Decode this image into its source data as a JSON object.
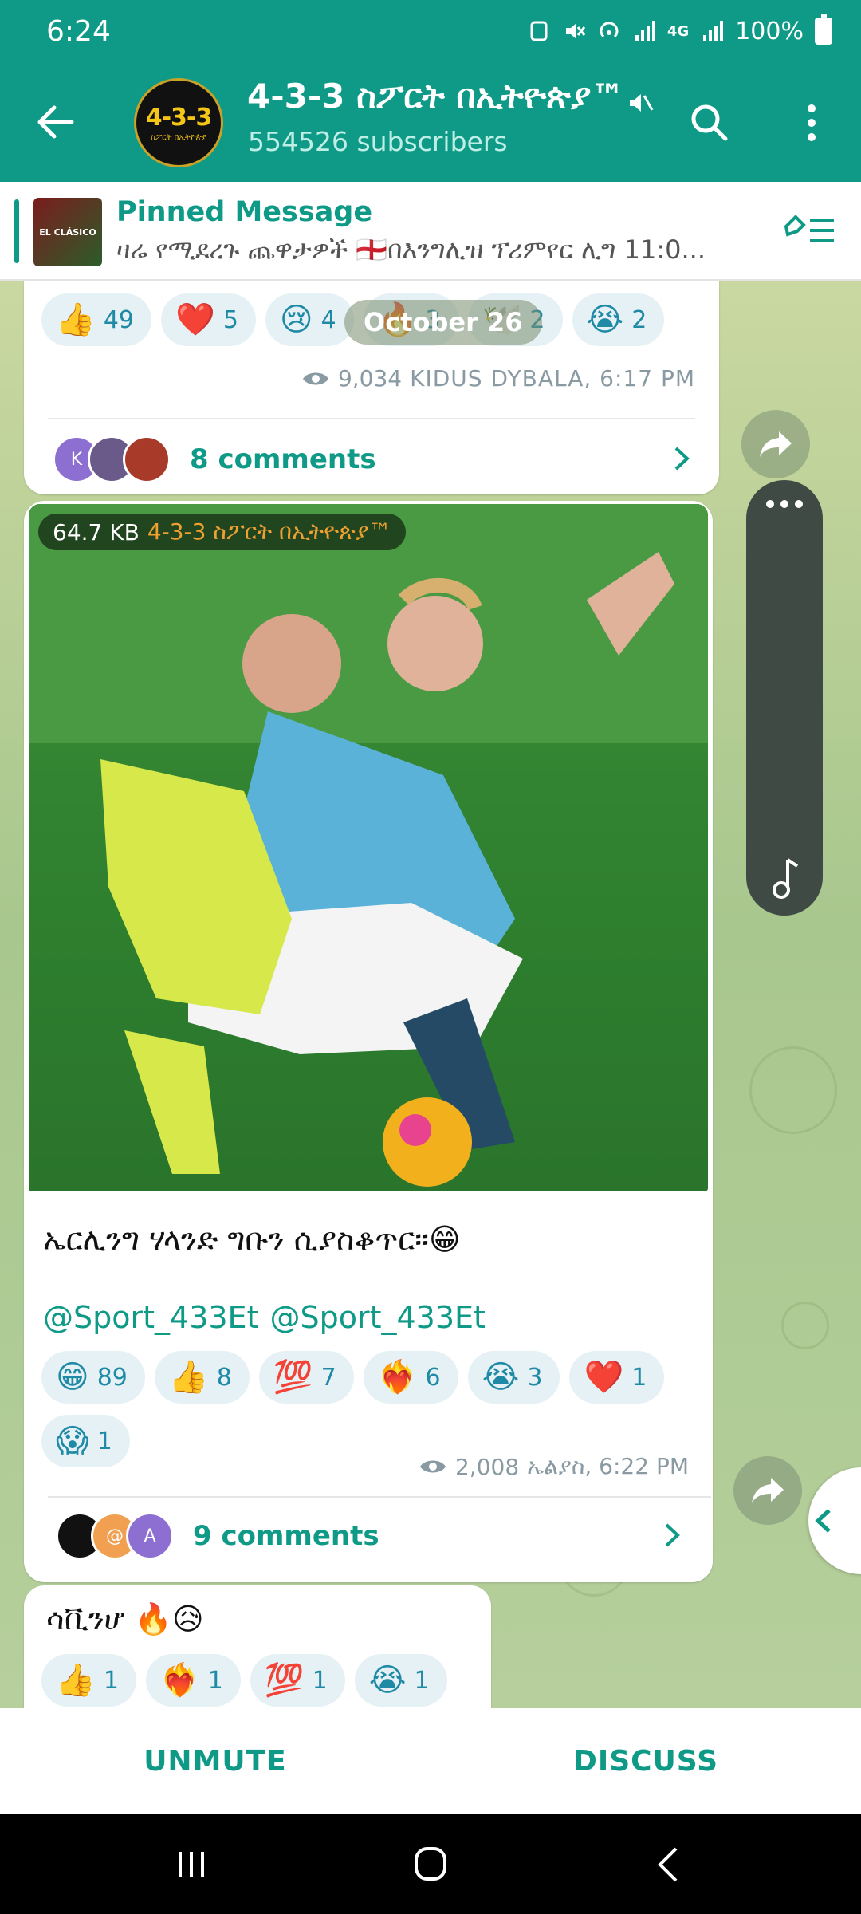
{
  "status_bar": {
    "time": "6:24",
    "network": "4G",
    "battery": "100%"
  },
  "header": {
    "logo_main": "4-3-3",
    "logo_sub": "ስፖርት በኢትዮጵያ",
    "title": "4-3-3 ስፖርት በኢትዮጵያ™",
    "subtitle": "554526 subscribers"
  },
  "pinned": {
    "thumb_text": "EL CLÁSICO",
    "title": "Pinned Message",
    "text": "ዛሬ የሚደረጉ ጨዋታዎች 🏴󠁧󠁢󠁥󠁮󠁧󠁿በእንግሊዝ ፕሪምየር ሊግ 11:0..."
  },
  "date_pill": "October 26",
  "post1": {
    "reactions": [
      {
        "emoji": "👍",
        "count": "49"
      },
      {
        "emoji": "❤️",
        "count": "5"
      },
      {
        "emoji": "😢",
        "count": "4"
      },
      {
        "emoji": "🔥",
        "count": "3"
      },
      {
        "emoji": "🕊️",
        "count": "2"
      },
      {
        "emoji": "😭",
        "count": "2"
      }
    ],
    "views": "9,034",
    "author_time": "KIDUS DYBALA, 6:17 PM",
    "comment_avatar_letter": "K",
    "comments": "8 comments"
  },
  "post2": {
    "file_size": "64.7 KB",
    "channel": "4-3-3 ስፖርት በኢትዮጵያ™",
    "caption": "ኤርሊንግ ሃላንድ ግቡን ሲያስቆጥር።😁",
    "links": [
      "@Sport_433Et",
      "@Sport_433Et"
    ],
    "reactions": [
      {
        "emoji": "😁",
        "count": "89"
      },
      {
        "emoji": "👍",
        "count": "8"
      },
      {
        "emoji": "💯",
        "count": "7"
      },
      {
        "emoji": "❤️‍🔥",
        "count": "6"
      },
      {
        "emoji": "😭",
        "count": "3"
      },
      {
        "emoji": "❤️",
        "count": "1"
      },
      {
        "emoji": "😱",
        "count": "1"
      }
    ],
    "views": "2,008",
    "author_time": "ኤልያስ, 6:22 PM",
    "comment_avatar_letters": [
      "@",
      "A"
    ],
    "comments": "9 comments"
  },
  "post3": {
    "caption": "ሳቪንሆ 🔥😥",
    "reactions": [
      {
        "emoji": "👍",
        "count": "1"
      },
      {
        "emoji": "❤️‍🔥",
        "count": "1"
      },
      {
        "emoji": "💯",
        "count": "1"
      },
      {
        "emoji": "😭",
        "count": "1"
      }
    ]
  },
  "actions": {
    "unmute": "UNMUTE",
    "discuss": "DISCUSS"
  },
  "colors": {
    "accent": "#0e9a86",
    "reaction_bg": "#e6f1f5",
    "reaction_text": "#1f8aa6"
  }
}
